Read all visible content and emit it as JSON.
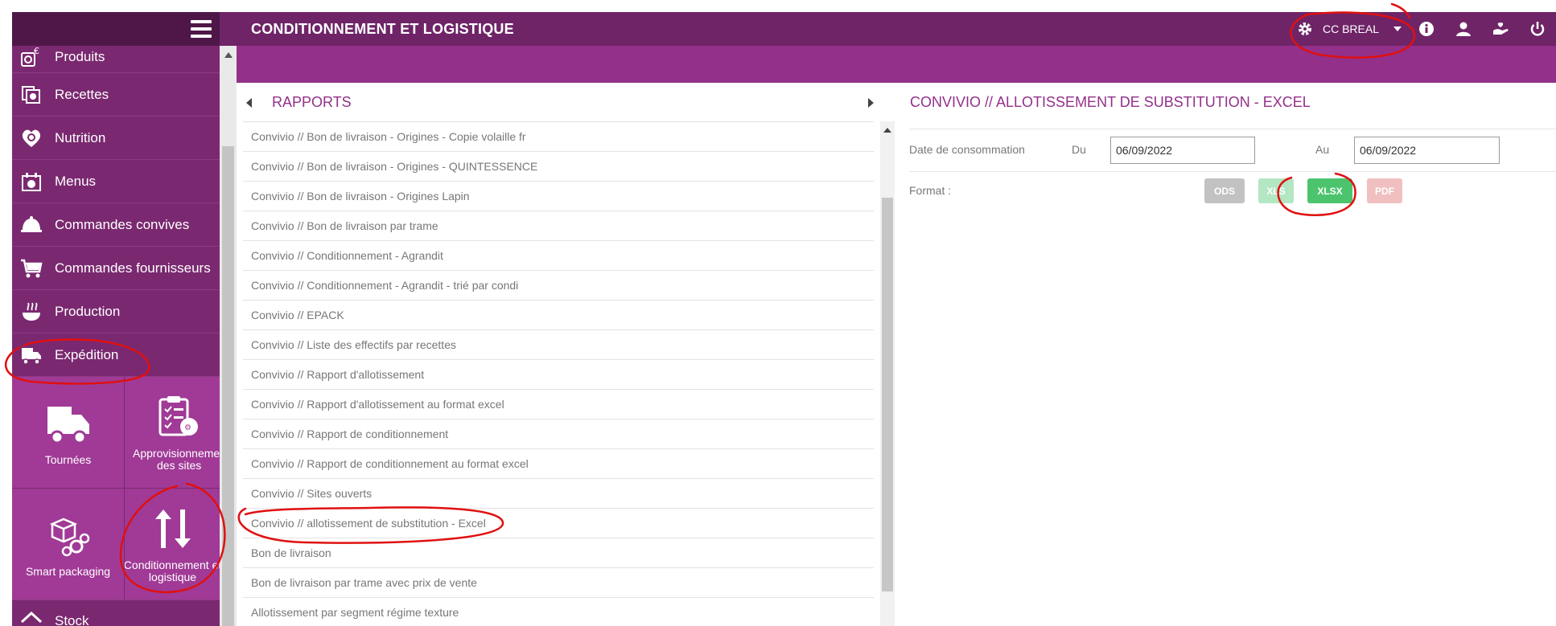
{
  "header": {
    "title": "CONDITIONNEMENT ET LOGISTIQUE",
    "site_name": "CC BREAL"
  },
  "sidebar": {
    "items": [
      {
        "label": "Produits",
        "icon": "products-icon"
      },
      {
        "label": "Recettes",
        "icon": "recipes-icon"
      },
      {
        "label": "Nutrition",
        "icon": "heart-icon"
      },
      {
        "label": "Menus",
        "icon": "menu-icon"
      },
      {
        "label": "Commandes convives",
        "icon": "cloche-icon"
      },
      {
        "label": "Commandes fournisseurs",
        "icon": "cart-icon"
      },
      {
        "label": "Production",
        "icon": "cooking-pot-icon"
      },
      {
        "label": "Expédition",
        "icon": "truck-icon"
      }
    ],
    "tiles": [
      {
        "label_line1": "Tournées",
        "label_line2": "",
        "icon": "truck-icon"
      },
      {
        "label_line1": "Approvisionnement",
        "label_line2": "des sites",
        "icon": "clipboard-icon"
      },
      {
        "label_line1": "Smart packaging",
        "label_line2": "",
        "icon": "boxes-gears-icon"
      },
      {
        "label_line1": "Conditionnement et",
        "label_line2": "logistique",
        "icon": "up-down-arrows-icon"
      }
    ],
    "partial_next_item": "Stock"
  },
  "rapports": {
    "title": "RAPPORTS",
    "items": [
      "Convivio // Bon de livraison - Origines - Copie volaille fr",
      "Convivio // Bon de livraison - Origines - QUINTESSENCE",
      "Convivio // Bon de livraison - Origines Lapin",
      "Convivio // Bon de livraison par trame",
      "Convivio // Conditionnement - Agrandit",
      "Convivio // Conditionnement - Agrandit - trié par condi",
      "Convivio // EPACK",
      "Convivio // Liste des effectifs par recettes",
      "Convivio // Rapport d'allotissement",
      "Convivio // Rapport d'allotissement au format excel",
      "Convivio // Rapport de conditionnement",
      "Convivio // Rapport de conditionnement au format excel",
      "Convivio // Sites ouverts",
      "Convivio // allotissement de substitution - Excel",
      "Bon de livraison",
      "Bon de livraison par trame avec prix de vente",
      "Allotissement par segment régime texture"
    ]
  },
  "form": {
    "title": "CONVIVIO // ALLOTISSEMENT DE SUBSTITUTION - EXCEL",
    "date_label": "Date de consommation",
    "du_label": "Du",
    "du_value": "06/09/2022",
    "au_label": "Au",
    "au_value": "06/09/2022",
    "format_label": "Format :",
    "formats": [
      {
        "label": "ODS",
        "color": "#c2c2c2"
      },
      {
        "label": "XLS",
        "color": "#b3e6c2"
      },
      {
        "label": "XLSX",
        "color": "#4cc46e"
      },
      {
        "label": "PDF",
        "color": "#f0c0c0"
      }
    ]
  },
  "colors": {
    "brand_dark": "#6e2467",
    "brand": "#93308a",
    "sidebar": "#7a2970",
    "tile": "#a03a96",
    "annotation_red": "#e01010"
  }
}
